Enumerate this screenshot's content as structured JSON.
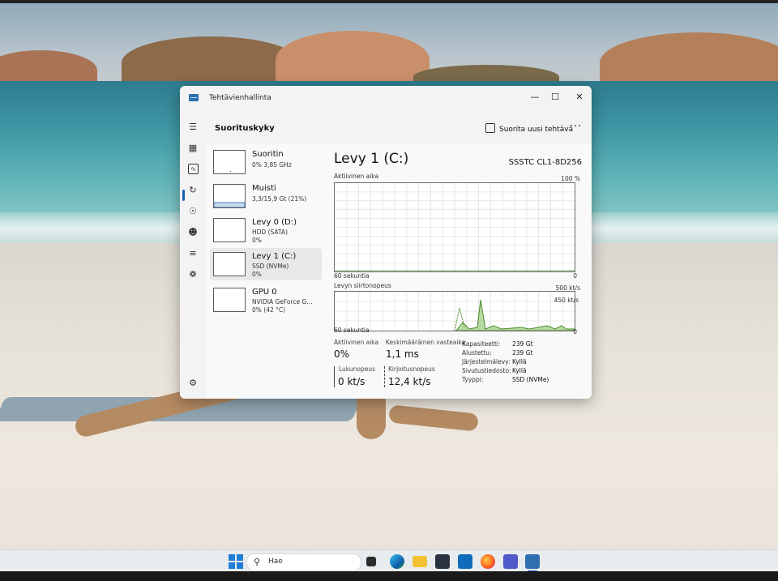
{
  "window": {
    "title": "Tehtävienhallinta",
    "controls": [
      "minimize",
      "maximize",
      "close"
    ]
  },
  "header": {
    "title": "Suorituskyky",
    "run_task_label": "Suorita uusi tehtävä",
    "more_label": "···"
  },
  "nav_icons": [
    "hamburger-icon",
    "processes-icon",
    "performance-icon",
    "app-history-icon",
    "startup-icon",
    "users-icon",
    "details-icon",
    "services-icon",
    "settings-icon"
  ],
  "devices": [
    {
      "name": "Suoritin",
      "line1": "0% 3,85 GHz",
      "line2": ""
    },
    {
      "name": "Muisti",
      "line1": "3,3/15,9 Gt (21%)",
      "line2": ""
    },
    {
      "name": "Levy 0 (D:)",
      "line1": "HDD (SATA)",
      "line2": "0%"
    },
    {
      "name": "Levy 1 (C:)",
      "line1": "SSD (NVMe)",
      "line2": "0%"
    },
    {
      "name": "GPU 0",
      "line1": "NVIDIA GeForce G...",
      "line2": "0% (42 °C)"
    }
  ],
  "main": {
    "title": "Levy 1 (C:)",
    "model": "SSSTC CL1-8D256",
    "graph1": {
      "label": "Aktiivinen aika",
      "max": "100 %",
      "time": "60 sekuntia",
      "min": "0"
    },
    "graph2": {
      "label": "Levyn siirtonopeus",
      "max": "500 kt/s",
      "mid": "450 kt/s",
      "time": "60 sekuntia",
      "min": "0"
    },
    "stats": {
      "active_label": "Aktiivinen aika",
      "active_value": "0%",
      "response_label": "Keskimääräinen vasteaika",
      "response_value": "1,1 ms",
      "read_label": "Lukunopeus",
      "read_value": "0 kt/s",
      "write_label": "Kirjoitusnopeus",
      "write_value": "12,4 kt/s"
    },
    "properties": [
      {
        "k": "Kapasiteetti:",
        "v": "239 Gt"
      },
      {
        "k": "Alustettu:",
        "v": "239 Gt"
      },
      {
        "k": "Järjestelmälevy:",
        "v": "Kyllä"
      },
      {
        "k": "Sivutustiedosto:",
        "v": "Kyllä"
      },
      {
        "k": "Tyyppi:",
        "v": "SSD (NVMe)"
      }
    ]
  },
  "taskbar": {
    "search_placeholder": "Hae",
    "apps": [
      "windows-start-icon",
      "task-view-icon",
      "edge-icon",
      "file-explorer-icon",
      "store-icon",
      "outlook-icon",
      "firefox-icon",
      "teams-icon",
      "task-manager-icon"
    ]
  },
  "colors": {
    "accent": "#1a5fb4",
    "graph_read": "#8cc265",
    "graph_write": "#4b8a2a"
  }
}
